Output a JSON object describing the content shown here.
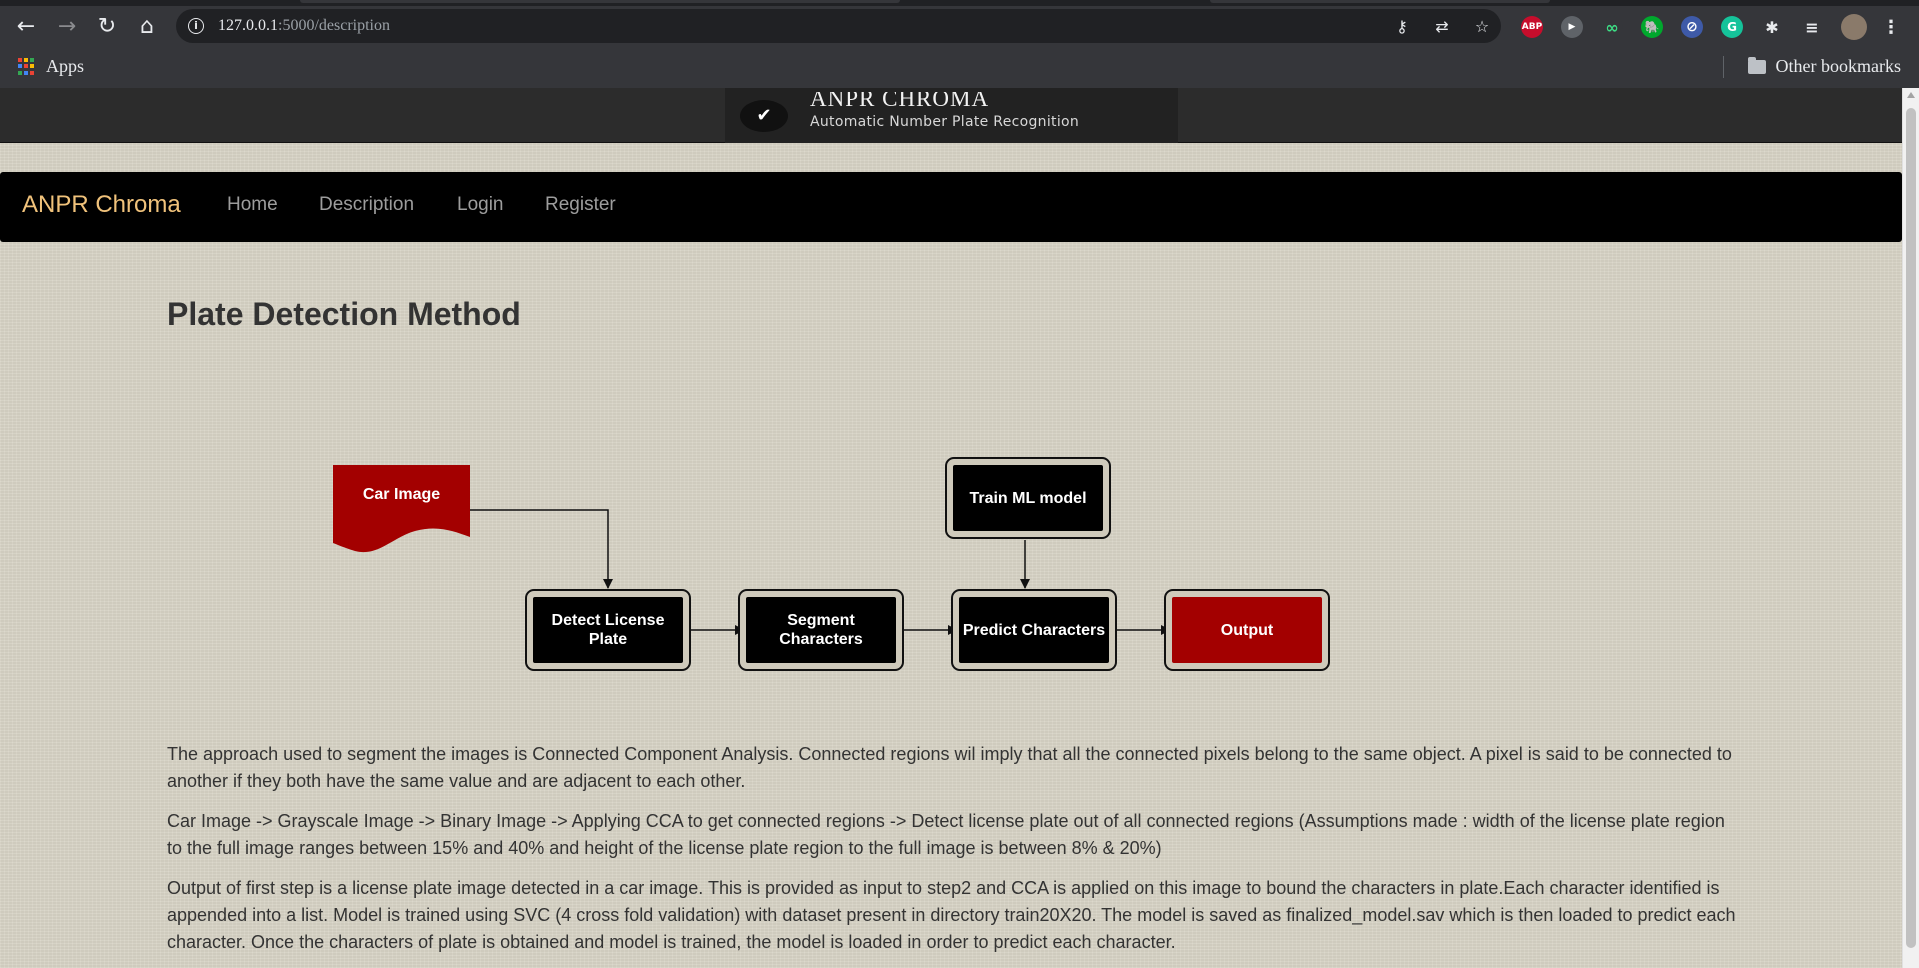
{
  "browser": {
    "url_host": "127.0.0.1",
    "url_path": ":5000/description",
    "bookmarks": {
      "apps_label": "Apps",
      "other_label": "Other bookmarks"
    },
    "extensions": [
      {
        "name": "adblock-icon",
        "label": "ABP",
        "color": "#c70d2c"
      },
      {
        "name": "play-extension-icon",
        "label": "▶",
        "color": "#5f6368"
      },
      {
        "name": "glasses-extension-icon",
        "label": "∞",
        "color": "#35363a"
      },
      {
        "name": "evernote-icon",
        "label": "🐘",
        "color": "#00a82d"
      },
      {
        "name": "block-site-icon",
        "label": "⊘",
        "color": "#3e5aa8"
      },
      {
        "name": "grammarly-icon",
        "label": "G",
        "color": "#15c39a"
      }
    ]
  },
  "site": {
    "header_title": "ANPR CHROMA",
    "header_subtitle": "Automatic Number Plate Recognition",
    "navbar": {
      "brand": "ANPR Chroma",
      "links": [
        "Home",
        "Description",
        "Login",
        "Register"
      ]
    },
    "page_title": "Plate Detection Method"
  },
  "diagram": {
    "nodes": {
      "car_image": "Car Image",
      "detect_plate": "Detect License Plate",
      "segment": "Segment Characters",
      "predict": "Predict Characters",
      "output": "Output",
      "train": "Train ML model"
    },
    "colors": {
      "accent_red": "#a30000",
      "node_black": "#000000"
    }
  },
  "paragraphs": [
    "The approach used to segment the images is Connected Component Analysis. Connected regions wil imply that all the connected pixels belong to the same object. A pixel is said to be connected to another if they both have the same value and are adjacent to each other.",
    "Car Image -> Grayscale Image -> Binary Image -> Applying CCA to get connected regions -> Detect license plate out of all connected regions (Assumptions made : width of the license plate region to the full image ranges between 15% and 40% and height of the license plate region to the full image is between 8% & 20%)",
    "Output of first step is a license plate image detected in a car image. This is provided as input to step2 and CCA is applied on this image to bound the characters in plate.Each character identified is appended into a list. Model is trained using SVC (4 cross fold validation) with dataset present in directory train20X20. The model is saved as finalized_model.sav which is then loaded to predict each character. Once the characters of plate is obtained and model is trained, the model is loaded in order to predict each character."
  ]
}
